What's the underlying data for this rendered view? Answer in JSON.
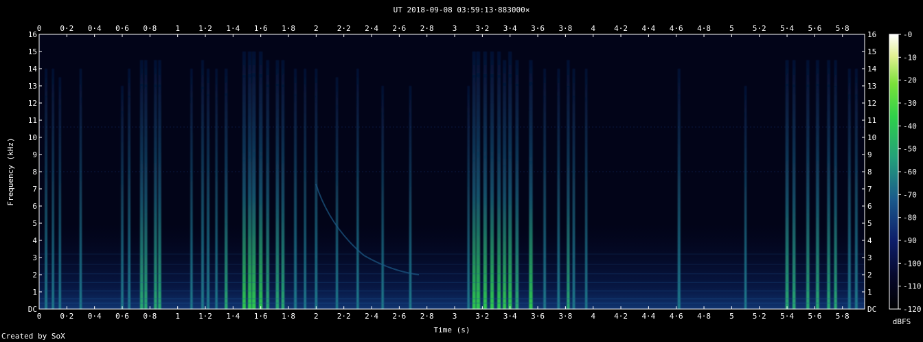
{
  "chart_data": {
    "type": "heatmap",
    "title": "UT 2018-09-08 03:59:13·883000×",
    "xlabel": "Time (s)",
    "ylabel": "Frequency (kHz)",
    "xlim": [
      0,
      5.96
    ],
    "ylim": [
      0,
      16
    ],
    "x_ticks": [
      "0",
      "0·2",
      "0·4",
      "0·6",
      "0·8",
      "1",
      "1·2",
      "1·4",
      "1·6",
      "1·8",
      "2",
      "2·2",
      "2·4",
      "2·6",
      "2·8",
      "3",
      "3·2",
      "3·4",
      "3·6",
      "3·8",
      "4",
      "4·2",
      "4·4",
      "4·6",
      "4·8",
      "5",
      "5·2",
      "5·4",
      "5·6",
      "5·8"
    ],
    "y_ticks": [
      "DC",
      "1",
      "2",
      "3",
      "4",
      "5",
      "6",
      "7",
      "8",
      "9",
      "10",
      "11",
      "12",
      "13",
      "14",
      "15",
      "16"
    ],
    "colorbar": {
      "label": "dBFS",
      "ticks": [
        "-0",
        "-10",
        "-20",
        "-30",
        "-40",
        "-50",
        "-60",
        "-70",
        "-80",
        "-90",
        "-100",
        "-110",
        "-120"
      ],
      "range": [
        -120,
        0
      ]
    },
    "events": [
      {
        "t": 0.05,
        "fmax": 14,
        "level": 0.35
      },
      {
        "t": 0.1,
        "fmax": 14,
        "level": 0.3
      },
      {
        "t": 0.15,
        "fmax": 13.5,
        "level": 0.3
      },
      {
        "t": 0.3,
        "fmax": 14,
        "level": 0.3
      },
      {
        "t": 0.6,
        "fmax": 13,
        "level": 0.35
      },
      {
        "t": 0.65,
        "fmax": 14,
        "level": 0.35
      },
      {
        "t": 0.74,
        "fmax": 14.5,
        "level": 0.55
      },
      {
        "t": 0.77,
        "fmax": 14.5,
        "level": 0.5
      },
      {
        "t": 0.84,
        "fmax": 14.5,
        "level": 0.5
      },
      {
        "t": 0.87,
        "fmax": 14.5,
        "level": 0.5
      },
      {
        "t": 1.1,
        "fmax": 14,
        "level": 0.3
      },
      {
        "t": 1.18,
        "fmax": 14.5,
        "level": 0.4
      },
      {
        "t": 1.22,
        "fmax": 14,
        "level": 0.4
      },
      {
        "t": 1.28,
        "fmax": 14,
        "level": 0.3
      },
      {
        "t": 1.35,
        "fmax": 14,
        "level": 0.45
      },
      {
        "t": 1.48,
        "fmax": 15,
        "level": 0.6
      },
      {
        "t": 1.52,
        "fmax": 15,
        "level": 0.65
      },
      {
        "t": 1.55,
        "fmax": 15,
        "level": 0.7
      },
      {
        "t": 1.6,
        "fmax": 15,
        "level": 0.65
      },
      {
        "t": 1.65,
        "fmax": 14.5,
        "level": 0.5
      },
      {
        "t": 1.72,
        "fmax": 14.5,
        "level": 0.55
      },
      {
        "t": 1.76,
        "fmax": 14.5,
        "level": 0.5
      },
      {
        "t": 1.85,
        "fmax": 14,
        "level": 0.4
      },
      {
        "t": 1.92,
        "fmax": 14,
        "level": 0.3
      },
      {
        "t": 2.0,
        "fmax": 14,
        "level": 0.35
      },
      {
        "t": 2.15,
        "fmax": 13.5,
        "level": 0.3
      },
      {
        "t": 2.3,
        "fmax": 14,
        "level": 0.3
      },
      {
        "t": 2.48,
        "fmax": 13,
        "level": 0.3
      },
      {
        "t": 2.68,
        "fmax": 13,
        "level": 0.3
      },
      {
        "t": 3.1,
        "fmax": 13,
        "level": 0.3
      },
      {
        "t": 3.14,
        "fmax": 15,
        "level": 0.6
      },
      {
        "t": 3.17,
        "fmax": 15,
        "level": 0.7
      },
      {
        "t": 3.22,
        "fmax": 15,
        "level": 0.65
      },
      {
        "t": 3.27,
        "fmax": 15,
        "level": 0.65
      },
      {
        "t": 3.32,
        "fmax": 15,
        "level": 0.6
      },
      {
        "t": 3.36,
        "fmax": 14.5,
        "level": 0.6
      },
      {
        "t": 3.4,
        "fmax": 15,
        "level": 0.65
      },
      {
        "t": 3.45,
        "fmax": 14.5,
        "level": 0.55
      },
      {
        "t": 3.55,
        "fmax": 14.5,
        "level": 0.65
      },
      {
        "t": 3.65,
        "fmax": 14,
        "level": 0.35
      },
      {
        "t": 3.75,
        "fmax": 14,
        "level": 0.35
      },
      {
        "t": 3.82,
        "fmax": 14.5,
        "level": 0.45
      },
      {
        "t": 3.86,
        "fmax": 14,
        "level": 0.35
      },
      {
        "t": 3.95,
        "fmax": 14,
        "level": 0.3
      },
      {
        "t": 4.62,
        "fmax": 14,
        "level": 0.4
      },
      {
        "t": 5.1,
        "fmax": 13,
        "level": 0.3
      },
      {
        "t": 5.4,
        "fmax": 14.5,
        "level": 0.55
      },
      {
        "t": 5.45,
        "fmax": 14.5,
        "level": 0.5
      },
      {
        "t": 5.55,
        "fmax": 14.5,
        "level": 0.5
      },
      {
        "t": 5.62,
        "fmax": 14.5,
        "level": 0.55
      },
      {
        "t": 5.7,
        "fmax": 14.5,
        "level": 0.5
      },
      {
        "t": 5.75,
        "fmax": 14.5,
        "level": 0.45
      },
      {
        "t": 5.85,
        "fmax": 14,
        "level": 0.4
      },
      {
        "t": 5.9,
        "fmax": 14,
        "level": 0.4
      }
    ]
  },
  "credit": "Created by SoX",
  "colors": {
    "background": "#000000",
    "plot_bg": "#020418",
    "low": "#0a1a55",
    "mid": "#1e7a8a",
    "high": "#32d24a"
  }
}
